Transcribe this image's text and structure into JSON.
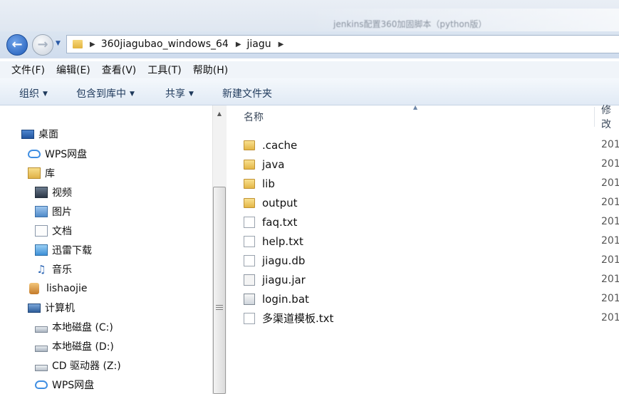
{
  "window": {
    "title": "jenkins配置360加固脚本（python版）"
  },
  "address": {
    "crumbs": [
      "360jiagubao_windows_64",
      "jiagu"
    ]
  },
  "menu": [
    "文件(F)",
    "编辑(E)",
    "查看(V)",
    "工具(T)",
    "帮助(H)"
  ],
  "toolbar": {
    "organize": "组织",
    "include_in_library": "包含到库中",
    "share": "共享",
    "new_folder": "新建文件夹"
  },
  "nav_tree": [
    {
      "label": "桌面",
      "icon": "desktop-icon"
    },
    {
      "label": "WPS网盘",
      "icon": "cloud-icon"
    },
    {
      "label": "库",
      "icon": "library-icon"
    },
    {
      "label": "视频",
      "icon": "video-icon"
    },
    {
      "label": "图片",
      "icon": "pictures-icon"
    },
    {
      "label": "文档",
      "icon": "documents-icon"
    },
    {
      "label": "迅雷下载",
      "icon": "xunlei-icon"
    },
    {
      "label": "音乐",
      "icon": "music-icon"
    },
    {
      "label": "lishaojie",
      "icon": "user-folder-icon"
    },
    {
      "label": "计算机",
      "icon": "computer-icon"
    },
    {
      "label": "本地磁盘 (C:)",
      "icon": "drive-icon"
    },
    {
      "label": "本地磁盘 (D:)",
      "icon": "drive-icon"
    },
    {
      "label": "CD 驱动器 (Z:)",
      "icon": "cd-drive-icon"
    },
    {
      "label": "WPS网盘",
      "icon": "cloud-icon"
    }
  ],
  "columns": {
    "name": "名称",
    "modified": "修改"
  },
  "files": [
    {
      "name": ".cache",
      "type": "folder",
      "date": "201"
    },
    {
      "name": "java",
      "type": "folder",
      "date": "201"
    },
    {
      "name": "lib",
      "type": "folder",
      "date": "201"
    },
    {
      "name": "output",
      "type": "folder",
      "date": "201"
    },
    {
      "name": "faq.txt",
      "type": "txt",
      "date": "201"
    },
    {
      "name": "help.txt",
      "type": "txt",
      "date": "201"
    },
    {
      "name": "jiagu.db",
      "type": "db",
      "date": "201"
    },
    {
      "name": "jiagu.jar",
      "type": "jar",
      "date": "201"
    },
    {
      "name": "login.bat",
      "type": "bat",
      "date": "201"
    },
    {
      "name": "多渠道模板.txt",
      "type": "txt",
      "date": "201"
    }
  ],
  "colors": {
    "accent": "#1f5bb8",
    "toolbar_text": "#1e395b"
  }
}
